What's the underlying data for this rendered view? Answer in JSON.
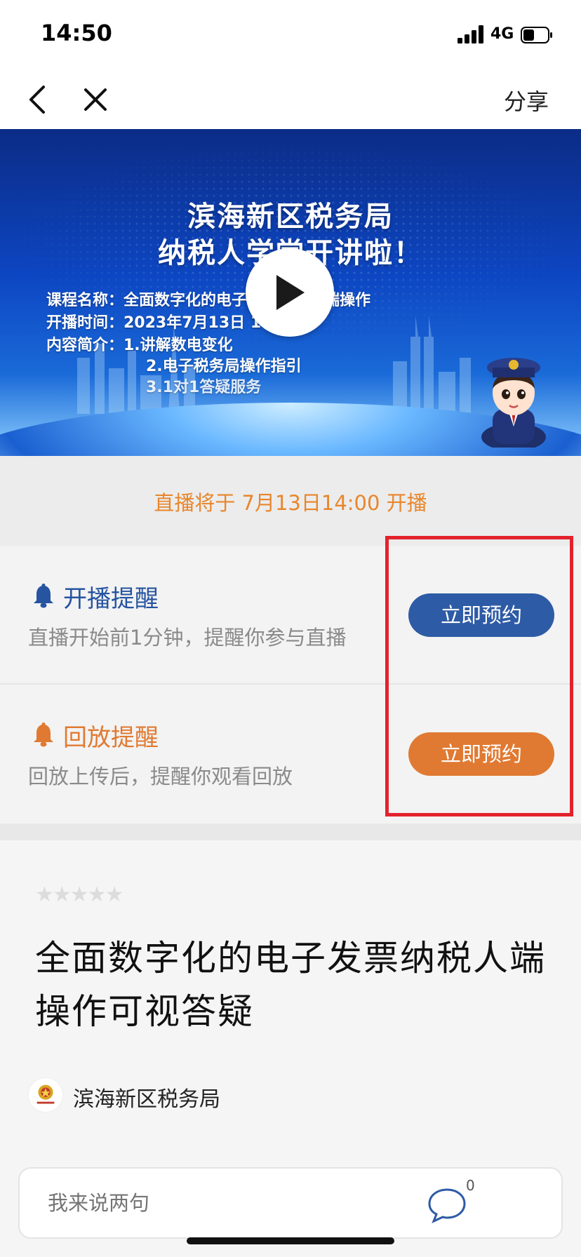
{
  "status": {
    "time": "14:50",
    "network": "4G"
  },
  "nav": {
    "share": "分享"
  },
  "video": {
    "title_line1": "滨海新区税务局",
    "title_line2": "纳税人学堂开讲啦！",
    "info": [
      "课程名称：全面数字化的电子发票纳税人端操作",
      "开播时间：2023年7月13日 14:00",
      "内容简介：1.讲解数电变化",
      "2.电子税务局操作指引",
      "3.1对1答疑服务"
    ]
  },
  "live_notice": "直播将于 7月13日14:00 开播",
  "reminders": [
    {
      "title": "开播提醒",
      "desc": "直播开始前1分钟，提醒你参与直播",
      "button": "立即预约",
      "color": "#2e5ba5"
    },
    {
      "title": "回放提醒",
      "desc": "回放上传后，提醒你观看回放",
      "button": "立即预约",
      "color": "#e07a32"
    }
  ],
  "rating": {
    "stars": "★★★★★",
    "value": 0,
    "max": 5
  },
  "course_title": "全面数字化的电子发票纳税人端操作可视答疑",
  "org_name": "滨海新区税务局",
  "comment": {
    "placeholder": "我来说两句",
    "count": "0"
  },
  "colors": {
    "accent_blue": "#2e5ba5",
    "accent_orange": "#e07a32",
    "highlight_red": "#e3222c"
  }
}
